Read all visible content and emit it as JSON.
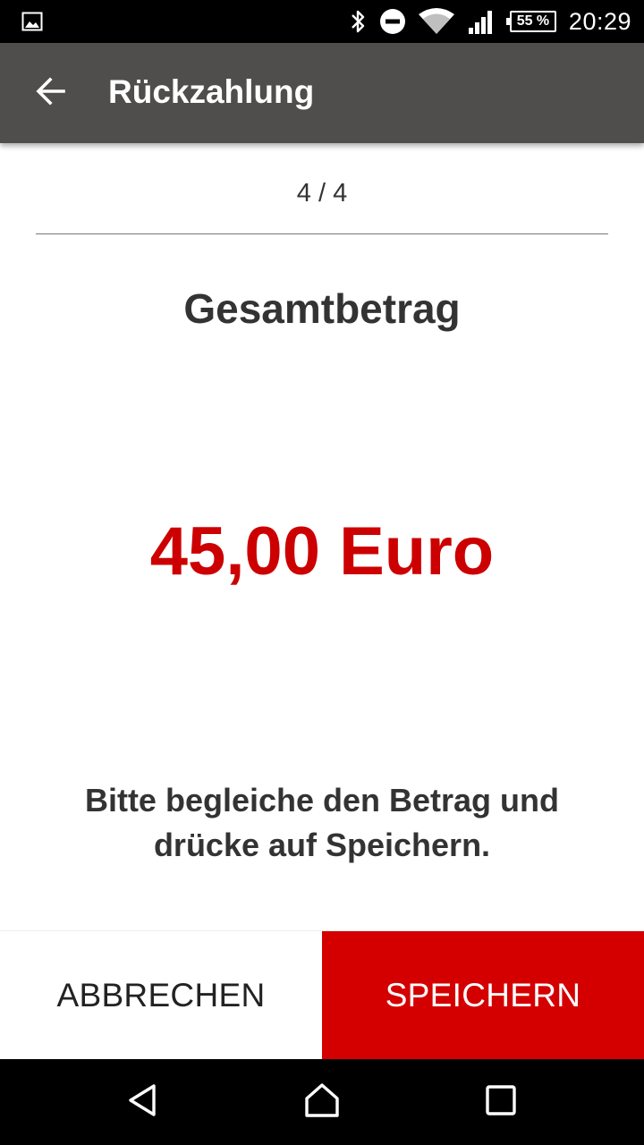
{
  "status_bar": {
    "time": "20:29",
    "battery": "55 %",
    "icons": [
      "image-notification-icon",
      "bluetooth-icon",
      "do-not-disturb-icon",
      "wifi-icon",
      "cell-signal-icon",
      "battery-icon"
    ]
  },
  "app_bar": {
    "title": "Rückzahlung",
    "back_icon": "arrow-back-icon"
  },
  "main": {
    "step": "4 / 4",
    "heading": "Gesamtbetrag",
    "amount": "45,00 Euro",
    "instruction": "Bitte begleiche den Betrag und drücke auf Speichern."
  },
  "actions": {
    "cancel_label": "ABBRECHEN",
    "save_label": "SPEICHERN"
  },
  "nav_bar": {
    "icons": [
      "back-triangle-icon",
      "home-icon",
      "recents-icon"
    ]
  },
  "colors": {
    "app_bar": "#4f4e4d",
    "accent_red": "#d40000",
    "amount_red": "#cc0000",
    "text_dark": "#333333"
  }
}
